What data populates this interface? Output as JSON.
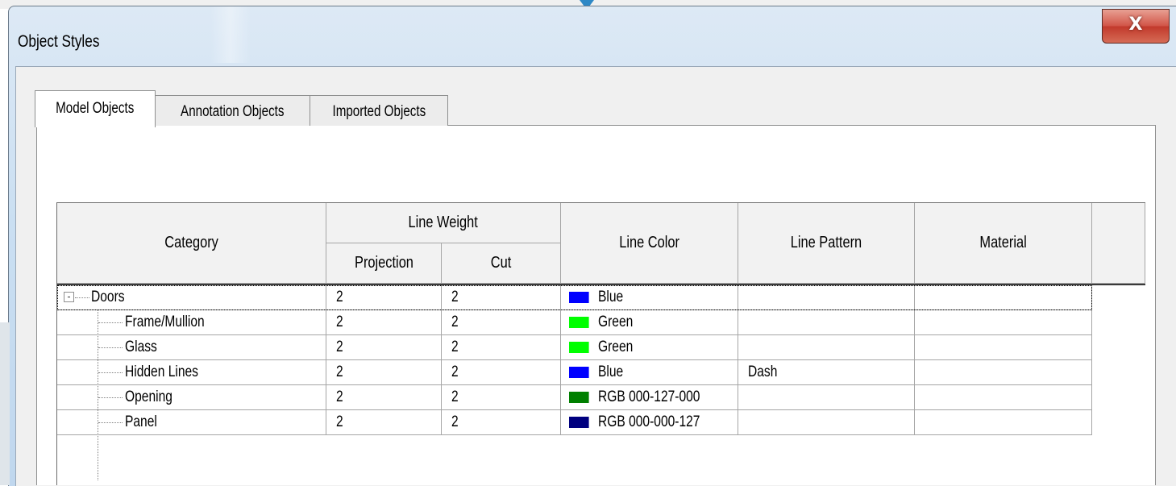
{
  "window": {
    "title": "Object Styles",
    "close_label": "X"
  },
  "tabs": [
    {
      "label": "Model Objects",
      "active": true
    },
    {
      "label": "Annotation Objects",
      "active": false
    },
    {
      "label": "Imported Objects",
      "active": false
    }
  ],
  "table": {
    "headers": {
      "category": "Category",
      "line_weight": "Line Weight",
      "projection": "Projection",
      "cut": "Cut",
      "line_color": "Line Color",
      "line_pattern": "Line Pattern",
      "material": "Material"
    },
    "rows": [
      {
        "category": "Doors",
        "projection": "2",
        "cut": "2",
        "color_name": "Blue",
        "color_hex": "#0000ff",
        "pattern": "",
        "material": ""
      },
      {
        "category": "Frame/Mullion",
        "projection": "2",
        "cut": "2",
        "color_name": "Green",
        "color_hex": "#00ff00",
        "pattern": "",
        "material": ""
      },
      {
        "category": "Glass",
        "projection": "2",
        "cut": "2",
        "color_name": "Green",
        "color_hex": "#00ff00",
        "pattern": "",
        "material": ""
      },
      {
        "category": "Hidden Lines",
        "projection": "2",
        "cut": "2",
        "color_name": "Blue",
        "color_hex": "#0000ff",
        "pattern": "Dash",
        "material": ""
      },
      {
        "category": "Opening",
        "projection": "2",
        "cut": "2",
        "color_name": "RGB 000-127-000",
        "color_hex": "#007f00",
        "pattern": "",
        "material": ""
      },
      {
        "category": "Panel",
        "projection": "2",
        "cut": "2",
        "color_name": "RGB 000-000-127",
        "color_hex": "#00007f",
        "pattern": "",
        "material": ""
      }
    ]
  },
  "icons": {
    "collapse": "minus-box-icon",
    "close": "close-icon"
  },
  "colors": {
    "close_button": "#c9463a",
    "title_bar": "#cadff2"
  }
}
